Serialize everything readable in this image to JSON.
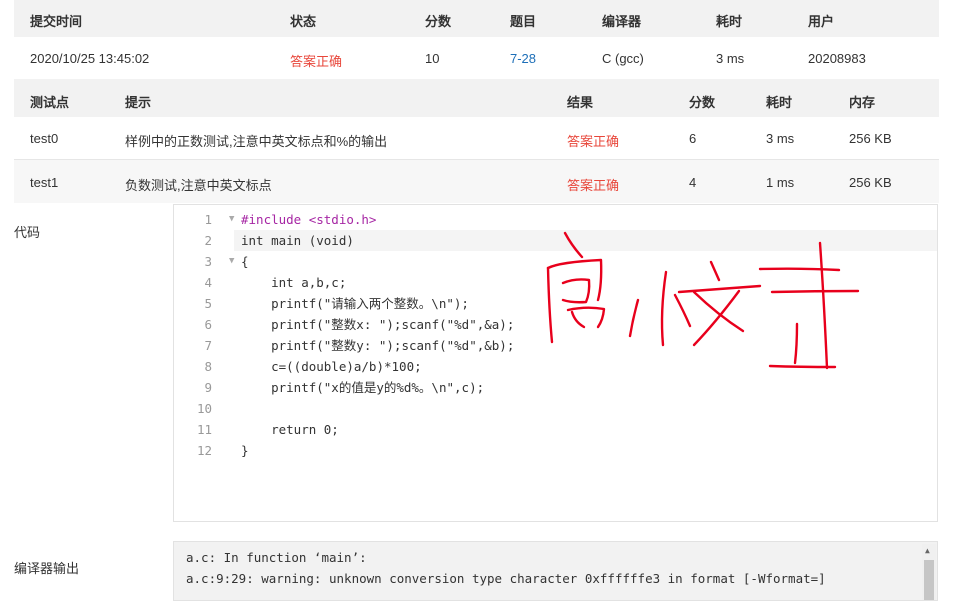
{
  "submission": {
    "headers": [
      "提交时间",
      "状态",
      "分数",
      "题目",
      "编译器",
      "耗时",
      "用户"
    ],
    "row": {
      "time": "2020/10/25 13:45:02",
      "status": "答案正确",
      "score": "10",
      "problem": "7-28",
      "compiler": "C (gcc)",
      "elapsed": "3 ms",
      "user": "20208983"
    }
  },
  "testpoints": {
    "headers": [
      "测试点",
      "提示",
      "结果",
      "分数",
      "耗时",
      "内存"
    ],
    "rows": [
      {
        "name": "test0",
        "hint": "样例中的正数测试,注意中英文标点和%的输出",
        "result": "答案正确",
        "score": "6",
        "time": "3 ms",
        "memory": "256 KB"
      },
      {
        "name": "test1",
        "hint": "负数测试,注意中英文标点",
        "result": "答案正确",
        "score": "4",
        "time": "1 ms",
        "memory": "256 KB"
      }
    ]
  },
  "code_label": "代码",
  "code_lines": [
    "#include <stdio.h>",
    "int main (void)",
    "{",
    "    int a,b,c;",
    "    printf(\"请输入两个整数。\\n\");",
    "    printf(\"整数x: \");scanf(\"%d\",&a);",
    "    printf(\"整数y: \");scanf(\"%d\",&b);",
    "    c=((double)a/b)*100;",
    "    printf(\"x的值是y的%d%。\\n\",c);",
    "    ",
    "    return 0;",
    "}"
  ],
  "line_numbers": [
    "1",
    "2",
    "3",
    "4",
    "5",
    "6",
    "7",
    "8",
    "9",
    "10",
    "11",
    "12"
  ],
  "compiler_output_label": "编译器输出",
  "compiler_output": [
    "a.c: In function ‘main’:",
    "a.c:9:29: warning: unknown conversion type character 0xffffffe3 in format [-Wformat=]"
  ],
  "colors": {
    "accepted": "#e8473b",
    "link": "#1d6fb8",
    "ink": "#e8001c"
  }
}
